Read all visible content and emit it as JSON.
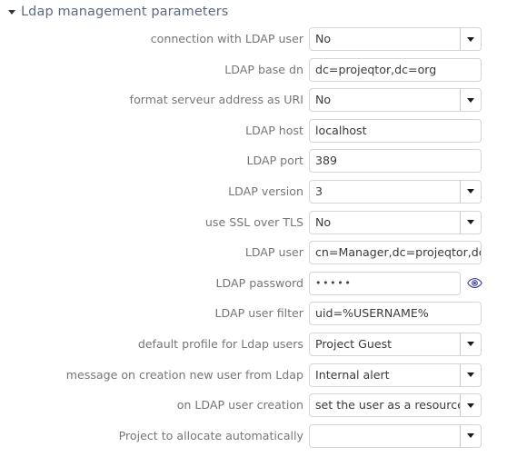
{
  "section": {
    "title": "Ldap management parameters",
    "caret_icon": "triangle-down-icon",
    "collapsed": false
  },
  "colors": {
    "section_title": "#5a6a82",
    "label": "#767676",
    "value": "#3a3a3a",
    "field_border": "#d5d5d5",
    "eye_icon": "#4b4ba0",
    "background": "#ffffff"
  },
  "form": {
    "rows": [
      {
        "label": "connection with LDAP user",
        "type": "select",
        "value": "No",
        "name": "connection-with-ldap-user"
      },
      {
        "label": "LDAP base dn",
        "type": "text",
        "value": "dc=projeqtor,dc=org",
        "name": "ldap-base-dn"
      },
      {
        "label": "format serveur address as URI",
        "type": "select",
        "value": "No",
        "name": "format-serveur-address-as-uri"
      },
      {
        "label": "LDAP host",
        "type": "text",
        "value": "localhost",
        "name": "ldap-host"
      },
      {
        "label": "LDAP port",
        "type": "text",
        "value": "389",
        "name": "ldap-port"
      },
      {
        "label": "LDAP version",
        "type": "select",
        "value": "3",
        "name": "ldap-version"
      },
      {
        "label": "use SSL over TLS",
        "type": "select",
        "value": "No",
        "name": "use-ssl-over-tls"
      },
      {
        "label": "LDAP user",
        "type": "text",
        "value": "cn=Manager,dc=projeqtor,dc=",
        "name": "ldap-user"
      },
      {
        "label": "LDAP password",
        "type": "password",
        "value": "•••••",
        "name": "ldap-password",
        "trailing_icon": "eye-icon"
      },
      {
        "label": "LDAP user filter",
        "type": "text",
        "value": "uid=%USERNAME%",
        "name": "ldap-user-filter"
      },
      {
        "label": "default profile for Ldap users",
        "type": "select",
        "value": "Project Guest",
        "name": "default-profile-for-ldap-users"
      },
      {
        "label": "message on creation new user from Ldap",
        "type": "select",
        "value": "Internal alert",
        "name": "message-on-creation-new-user-from-ldap"
      },
      {
        "label": "on LDAP user creation",
        "type": "select",
        "value": "set the user as a resource",
        "name": "on-ldap-user-creation"
      },
      {
        "label": "Project to allocate automatically",
        "type": "select",
        "value": "",
        "name": "project-to-allocate-automatically"
      }
    ]
  }
}
